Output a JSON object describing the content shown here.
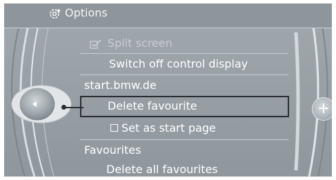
{
  "header": {
    "title": "Options",
    "icon": "settings-gear-icon"
  },
  "menu": {
    "split_screen": "Split screen",
    "switch_off": "Switch off control display",
    "start_url": "start.bmw.de",
    "delete_favourite": "Delete favourite",
    "set_start_page": "Set as start page",
    "favourites": "Favourites",
    "delete_all": "Delete all favourites"
  },
  "controls": {
    "plus": "+"
  },
  "colors": {
    "background": "#98a0a6",
    "selection_border": "#2a2c2e",
    "text": "#ffffff"
  }
}
